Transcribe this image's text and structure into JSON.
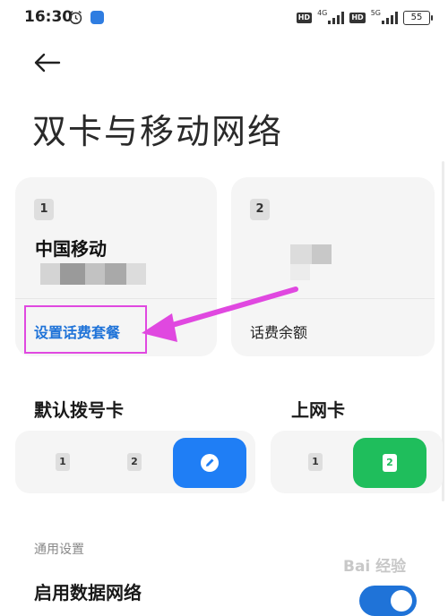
{
  "status_bar": {
    "time": "16:30",
    "hd_badge": "HD",
    "network_1": "4G",
    "network_2": "5G",
    "battery": "55",
    "icons": [
      "alarm-clock-icon",
      "app-notification-icon",
      "signal-strength-icon",
      "battery-icon"
    ]
  },
  "header": {
    "back_icon": "arrow-left-icon",
    "title": "双卡与移动网络"
  },
  "sim_cards": [
    {
      "slot": "1",
      "carrier": "中国移动",
      "action": "设置话费套餐"
    },
    {
      "slot": "2",
      "carrier": "",
      "action": "话费余额"
    }
  ],
  "default_dial": {
    "heading": "默认拨号卡",
    "options": [
      "1",
      "2"
    ],
    "active_icon": "edit-pen-icon",
    "active_color": "#1f7ef5"
  },
  "data_sim": {
    "heading": "上网卡",
    "options": [
      "1",
      "2"
    ],
    "active_color": "#1fbe5c"
  },
  "general": {
    "section_label": "通用设置",
    "enable_data_label": "启用数据网络"
  },
  "watermark": "Bai 经验",
  "colors": {
    "accent_blue": "#1f73d8",
    "accent_green": "#1fbe5c",
    "annotation_magenta": "#e048e0"
  }
}
